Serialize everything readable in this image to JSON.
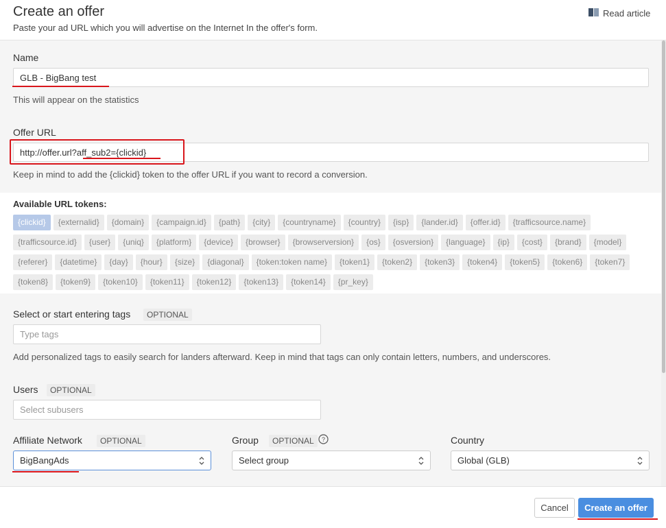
{
  "header": {
    "title": "Create an offer",
    "subtitle": "Paste your ad URL which you will advertise on the Internet In the offer's form.",
    "read_article": "Read article"
  },
  "name": {
    "label": "Name",
    "value": "GLB - BigBang test",
    "help": "This will appear on the statistics"
  },
  "offer_url": {
    "label": "Offer URL",
    "value": "http://offer.url?aff_sub2={clickid}",
    "help": "Keep in mind to add the {clickid} token to the offer URL if you want to record a conversion."
  },
  "tokens": {
    "label": "Available URL tokens:",
    "items": [
      "{clickid}",
      "{externalid}",
      "{domain}",
      "{campaign.id}",
      "{path}",
      "{city}",
      "{countryname}",
      "{country}",
      "{isp}",
      "{lander.id}",
      "{offer.id}",
      "{trafficsource.name}",
      "{trafficsource.id}",
      "{user}",
      "{uniq}",
      "{platform}",
      "{device}",
      "{browser}",
      "{browserversion}",
      "{os}",
      "{osversion}",
      "{language}",
      "{ip}",
      "{cost}",
      "{brand}",
      "{model}",
      "{referer}",
      "{datetime}",
      "{day}",
      "{hour}",
      "{size}",
      "{diagonal}",
      "{token:token name}",
      "{token1}",
      "{token2}",
      "{token3}",
      "{token4}",
      "{token5}",
      "{token6}",
      "{token7}",
      "{token8}",
      "{token9}",
      "{token10}",
      "{token11}",
      "{token12}",
      "{token13}",
      "{token14}",
      "{pr_key}"
    ]
  },
  "tags": {
    "label": "Select or start entering tags",
    "badge": "OPTIONAL",
    "placeholder": "Type tags",
    "help": "Add personalized tags to easily search for landers afterward. Keep in mind that tags can only contain letters, numbers, and underscores."
  },
  "users": {
    "label": "Users",
    "badge": "OPTIONAL",
    "placeholder": "Select subusers"
  },
  "affiliate_network": {
    "label": "Affiliate Network",
    "badge": "OPTIONAL",
    "value": "BigBangAds"
  },
  "group": {
    "label": "Group",
    "badge": "OPTIONAL",
    "value": "Select group"
  },
  "country": {
    "label": "Country",
    "value": "Global (GLB)"
  },
  "footer": {
    "cancel": "Cancel",
    "create": "Create an offer"
  },
  "colors": {
    "annotation_red": "#d9151b",
    "primary_blue": "#4a8ee0",
    "active_token": "#b6c9e8"
  },
  "icons": [
    "book-icon",
    "chevron-updown-icon",
    "question-circle-icon"
  ]
}
